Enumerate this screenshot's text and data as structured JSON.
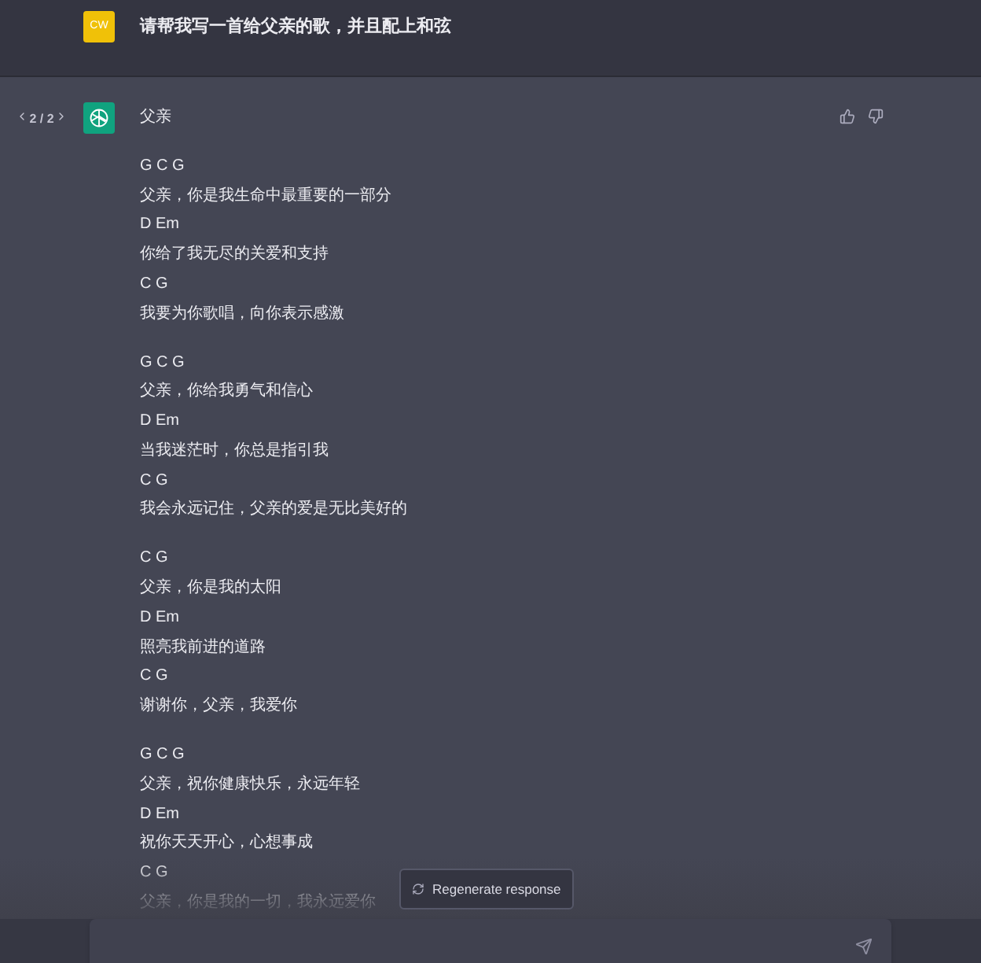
{
  "user_message": {
    "avatar": "CW",
    "text": "请帮我写一首给父亲的歌，并且配上和弦"
  },
  "assistant_message": {
    "pager": "2 / 2",
    "title": "父亲",
    "stanzas": [
      {
        "lines": [
          "G C G",
          "父亲，你是我生命中最重要的一部分",
          "D Em",
          "你给了我无尽的关爱和支持",
          "C G",
          "我要为你歌唱，向你表示感激"
        ]
      },
      {
        "lines": [
          "G C G",
          "父亲，你给我勇气和信心",
          "D Em",
          "当我迷茫时，你总是指引我",
          "C G",
          "我会永远记住，父亲的爱是无比美好的"
        ]
      },
      {
        "lines": [
          "C G",
          "父亲，你是我的太阳",
          "D Em",
          "照亮我前进的道路",
          "C G",
          "谢谢你，父亲，我爱你"
        ]
      },
      {
        "lines": [
          "G C G",
          "父亲，祝你健康快乐，永远年轻",
          "D Em",
          "祝你天天开心，心想事成",
          "C G",
          "父亲，你是我的一切，我永远爱你"
        ]
      }
    ]
  },
  "regenerate_button": "Regenerate response"
}
